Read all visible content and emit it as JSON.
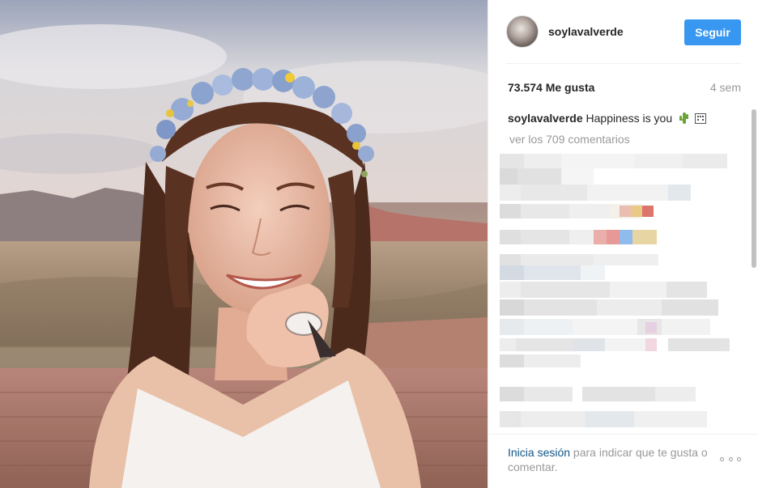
{
  "post": {
    "username": "soylavalverde",
    "follow_label": "Seguir",
    "likes": "73.574 Me gusta",
    "age": "4 sem",
    "caption_user": "soylavalverde",
    "caption_text": "Happiness is you",
    "view_comments": "ver los 709 comentarios"
  },
  "footer": {
    "login_link": "Inicia sesión",
    "login_rest": " para indicar que te gusta o comentar."
  },
  "colors": {
    "follow_button": "#3897f0",
    "link": "#125688",
    "muted_text": "#999999"
  },
  "icons": {
    "caption_emoji_1": "cactus-icon",
    "caption_emoji_2": "box-glyph-icon",
    "more": "more-options-icon"
  }
}
